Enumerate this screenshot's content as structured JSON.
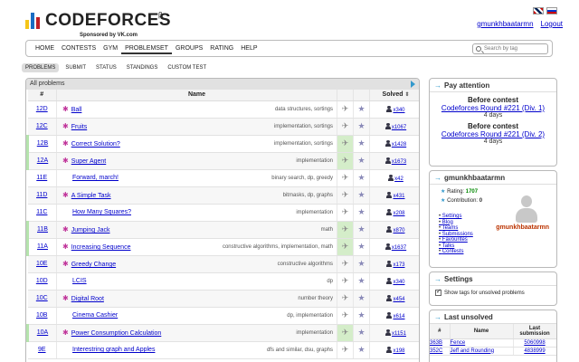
{
  "header": {
    "logo_text": "CODEFORCES",
    "logo_beta": "β",
    "sponsor": "Sponsored by VK.com",
    "username": "gmunkhbaatarmn",
    "logout": "Logout"
  },
  "nav": {
    "items": [
      "Home",
      "Contests",
      "Gym",
      "Problemset",
      "Groups",
      "Rating",
      "Help"
    ],
    "active": "Problemset",
    "search_placeholder": "Search by tag"
  },
  "subnav": {
    "items": [
      "Problems",
      "Submit",
      "Status",
      "Standings",
      "Custom test"
    ],
    "active": "Problems"
  },
  "problems": {
    "title": "All problems",
    "headers": {
      "id": "#",
      "name": "Name",
      "solved": "Solved"
    },
    "rows": [
      {
        "id": "12D",
        "name": "Ball",
        "tags": "data structures, sortings",
        "count": "x340",
        "solved": false,
        "star": true
      },
      {
        "id": "12C",
        "name": "Fruits",
        "tags": "implementation, sortings",
        "count": "x1067",
        "solved": false,
        "star": true
      },
      {
        "id": "12B",
        "name": "Correct Solution?",
        "tags": "implementation, sortings",
        "count": "x1428",
        "solved": true,
        "star": true
      },
      {
        "id": "12A",
        "name": "Super Agent",
        "tags": "implementation",
        "count": "x1673",
        "solved": true,
        "star": true
      },
      {
        "id": "11E",
        "name": "Forward, march!",
        "tags": "binary search, dp, greedy",
        "count": "x42",
        "solved": false,
        "star": false
      },
      {
        "id": "11D",
        "name": "A Simple Task",
        "tags": "bitmasks, dp, graphs",
        "count": "x431",
        "solved": false,
        "star": true
      },
      {
        "id": "11C",
        "name": "How Many Squares?",
        "tags": "implementation",
        "count": "x208",
        "solved": false,
        "star": false
      },
      {
        "id": "11B",
        "name": "Jumping Jack",
        "tags": "math",
        "count": "x870",
        "solved": true,
        "star": true
      },
      {
        "id": "11A",
        "name": "Increasing Sequence",
        "tags": "constructive algorithms, implementation, math",
        "count": "x1637",
        "solved": true,
        "star": true
      },
      {
        "id": "10E",
        "name": "Greedy Change",
        "tags": "constructive algorithms",
        "count": "x173",
        "solved": false,
        "star": true
      },
      {
        "id": "10D",
        "name": "LCIS",
        "tags": "dp",
        "count": "x340",
        "solved": false,
        "star": false
      },
      {
        "id": "10C",
        "name": "Digital Root",
        "tags": "number theory",
        "count": "x454",
        "solved": false,
        "star": true
      },
      {
        "id": "10B",
        "name": "Cinema Cashier",
        "tags": "dp, implementation",
        "count": "x614",
        "solved": false,
        "star": false
      },
      {
        "id": "10A",
        "name": "Power Consumption Calculation",
        "tags": "implementation",
        "count": "x1151",
        "solved": true,
        "star": true
      },
      {
        "id": "9E",
        "name": "Interestring graph and Apples",
        "tags": "dfs and similar, dsu, graphs",
        "count": "x198",
        "solved": false,
        "star": false
      }
    ]
  },
  "attention": {
    "title": "Pay attention",
    "contests": [
      {
        "before": "Before contest",
        "name": "Codeforces Round #221 (Div. 1)",
        "days": "4 days"
      },
      {
        "before": "Before contest",
        "name": "Codeforces Round #221 (Div. 2)",
        "days": "4 days"
      }
    ]
  },
  "profile": {
    "title": "gmunkhbaatarmn",
    "rating_label": "Rating:",
    "rating_value": "1707",
    "contribution_label": "Contribution:",
    "contribution_value": "0",
    "links": [
      "Settings",
      "Blog",
      "Teams",
      "Submissions",
      "Favourites",
      "Talks",
      "Contests"
    ],
    "avatar_name": "gmunkhbaatarmn"
  },
  "settings": {
    "title": "Settings",
    "checkbox_label": "Show tags for unsolved problems"
  },
  "last_unsolved": {
    "title": "Last unsolved",
    "headers": {
      "id": "#",
      "name": "Name",
      "last": "Last submission"
    },
    "rows": [
      {
        "id": "363B",
        "name": "Fence",
        "sub": "5060998"
      },
      {
        "id": "352C",
        "name": "Jeff and Rounding",
        "sub": "4838999"
      }
    ]
  },
  "colors": {
    "solved_green": "#d4edc9",
    "link_blue": "#0000cc",
    "star_magenta": "#c0349a",
    "logo_yellow": "#f5c518",
    "logo_blue": "#1a6dc3",
    "logo_red": "#c01f26"
  }
}
